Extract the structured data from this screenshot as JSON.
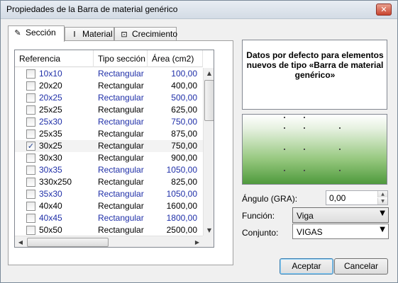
{
  "window": {
    "title": "Propiedades de la Barra de material genérico",
    "close_label": "✕"
  },
  "tabs": [
    {
      "label": "Sección",
      "icon": "pencil-icon",
      "glyph": "✎"
    },
    {
      "label": "Material",
      "icon": "i-beam-icon",
      "glyph": "I"
    },
    {
      "label": "Crecimiento",
      "icon": "growth-icon",
      "glyph": "⊡"
    }
  ],
  "table": {
    "columns": [
      "Referencia",
      "Tipo sección",
      "Área (cm2)"
    ],
    "rows": [
      {
        "ref": "10x10",
        "tipo": "Rectangular",
        "area": "100,00",
        "checked": false,
        "highlight": true
      },
      {
        "ref": "20x20",
        "tipo": "Rectangular",
        "area": "400,00",
        "checked": false,
        "highlight": false
      },
      {
        "ref": "20x25",
        "tipo": "Rectangular",
        "area": "500,00",
        "checked": false,
        "highlight": true
      },
      {
        "ref": "25x25",
        "tipo": "Rectangular",
        "area": "625,00",
        "checked": false,
        "highlight": false
      },
      {
        "ref": "25x30",
        "tipo": "Rectangular",
        "area": "750,00",
        "checked": false,
        "highlight": true
      },
      {
        "ref": "25x35",
        "tipo": "Rectangular",
        "area": "875,00",
        "checked": false,
        "highlight": false
      },
      {
        "ref": "30x25",
        "tipo": "Rectangular",
        "area": "750,00",
        "checked": true,
        "highlight": false
      },
      {
        "ref": "30x30",
        "tipo": "Rectangular",
        "area": "900,00",
        "checked": false,
        "highlight": false
      },
      {
        "ref": "30x35",
        "tipo": "Rectangular",
        "area": "1050,00",
        "checked": false,
        "highlight": true
      },
      {
        "ref": "330x250",
        "tipo": "Rectangular",
        "area": "825,00",
        "checked": false,
        "highlight": false
      },
      {
        "ref": "35x30",
        "tipo": "Rectangular",
        "area": "1050,00",
        "checked": false,
        "highlight": true
      },
      {
        "ref": "40x40",
        "tipo": "Rectangular",
        "area": "1600,00",
        "checked": false,
        "highlight": false
      },
      {
        "ref": "40x45",
        "tipo": "Rectangular",
        "area": "1800,00",
        "checked": false,
        "highlight": true
      },
      {
        "ref": "50x50",
        "tipo": "Rectangular",
        "area": "2500,00",
        "checked": false,
        "highlight": false
      }
    ]
  },
  "info": {
    "text": "Datos por defecto para elementos nuevos de tipo «Barra de material genérico»"
  },
  "angle": {
    "label": "Ángulo (GRA):",
    "value": "0,00"
  },
  "funcion": {
    "label": "Función:",
    "value": "Viga"
  },
  "conjunto": {
    "label": "Conjunto:",
    "value": "VIGAS"
  },
  "buttons": {
    "accept": "Aceptar",
    "cancel": "Cancelar"
  },
  "colors": {
    "highlight_text": "#1f2fa8",
    "accent": "#3c7fb1",
    "preview_green": "#4f9a3d"
  }
}
